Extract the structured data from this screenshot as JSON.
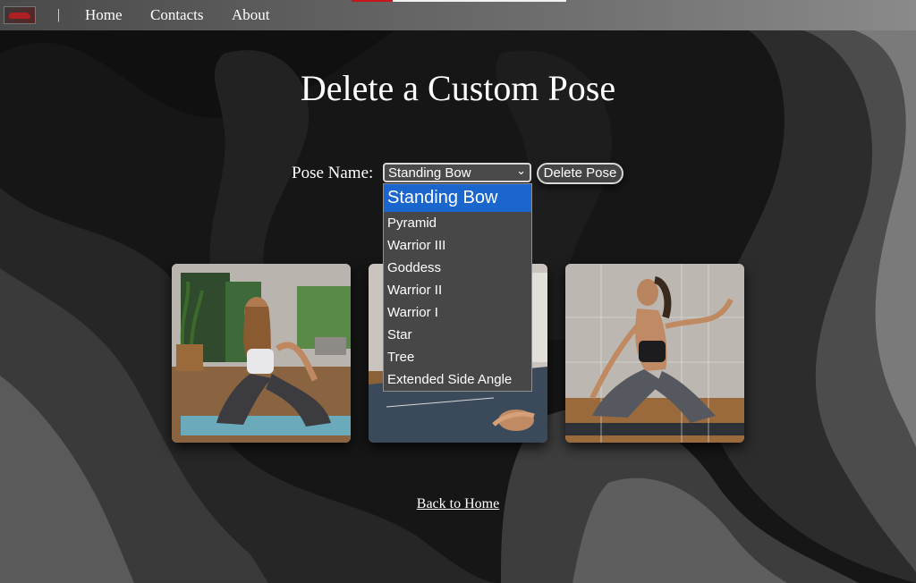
{
  "nav": {
    "separator": "|",
    "links": [
      "Home",
      "Contacts",
      "About"
    ]
  },
  "page": {
    "title": "Delete a Custom Pose"
  },
  "form": {
    "pose_label": "Pose Name:",
    "selected_pose": "Standing Bow",
    "delete_label": "Delete Pose",
    "options": [
      "Standing Bow",
      "Pyramid",
      "Warrior III",
      "Goddess",
      "Warrior II",
      "Warrior I",
      "Star",
      "Tree",
      "Extended Side Angle"
    ]
  },
  "footer": {
    "back_label": "Back to Home"
  },
  "colors": {
    "dropdown_highlight": "#1a66cc",
    "nav_accent_red": "#c4161c"
  },
  "icons": {
    "select_chevron": "chevron-down-icon"
  }
}
